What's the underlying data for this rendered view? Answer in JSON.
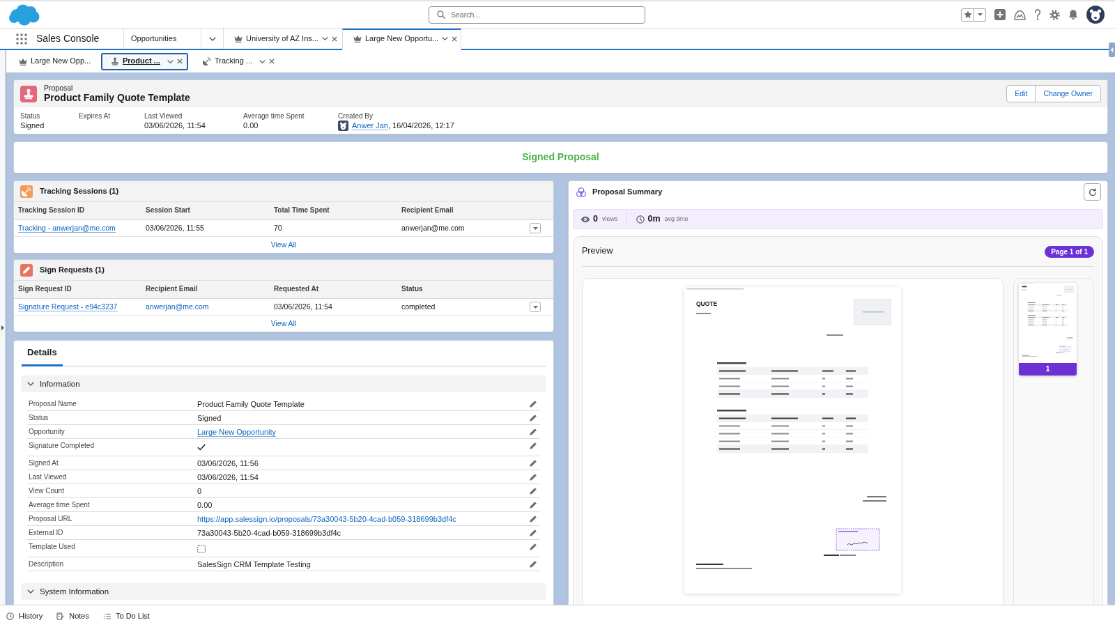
{
  "global_header": {
    "search": {
      "placeholder": "Search..."
    }
  },
  "app": {
    "name": "Sales Console"
  },
  "nav": {
    "object_tab": {
      "label": "Opportunities"
    },
    "tabs": [
      {
        "label": "University of AZ Ins...",
        "kind": "opportunity",
        "selected": false
      },
      {
        "label": "Large New Opportu...",
        "kind": "opportunity",
        "selected": true
      }
    ]
  },
  "subtabs": [
    {
      "label": "Large New Opp...",
      "kind": "opportunity",
      "selected": false,
      "closable": false
    },
    {
      "label": "Product ...",
      "kind": "proposal",
      "selected": true,
      "closable": true
    },
    {
      "label": "Tracking ...",
      "kind": "tracking",
      "selected": false,
      "closable": true
    }
  ],
  "record": {
    "object_label": "Proposal",
    "title": "Product Family Quote Template",
    "actions": [
      "Edit",
      "Change Owner"
    ],
    "highlights": [
      {
        "label": "Status",
        "kind": "text",
        "value": "Signed"
      },
      {
        "label": "Expires At",
        "kind": "text"
      },
      {
        "label": "Last Viewed",
        "kind": "text",
        "value": "03/06/2026, 11:54"
      },
      {
        "label": "Average time Spent",
        "kind": "text",
        "value": "0.00"
      },
      {
        "label": "Created By",
        "kind": "user",
        "value": "Anwer Jan",
        "suffix": ", 16/04/2026, 12:17"
      }
    ]
  },
  "status_banner": {
    "text": "Signed Proposal"
  },
  "related_lists": [
    {
      "kind": "tracking",
      "title": "Tracking Sessions (1)",
      "columns": [
        "Tracking Session ID",
        "Session Start",
        "Total Time Spent",
        "Recipient Email"
      ],
      "rows": [
        {
          "cells": [
            {
              "kind": "record_link",
              "text": "Tracking - anwerjan@me.com"
            },
            {
              "kind": "datetime",
              "text": "03/06/2026, 11:55"
            },
            {
              "kind": "number",
              "text": "70"
            },
            {
              "kind": "email",
              "text": "anwerjan@me.com"
            }
          ]
        }
      ],
      "view_all": "View All"
    },
    {
      "kind": "sign",
      "title": "Sign Requests (1)",
      "columns": [
        "Sign Request ID",
        "Recipient Email",
        "Requested At",
        "Status"
      ],
      "rows": [
        {
          "cells": [
            {
              "kind": "record_link",
              "text": "Signature Request - e94c3237"
            },
            {
              "kind": "email_link",
              "text": "anwerjan@me.com"
            },
            {
              "kind": "datetime",
              "text": "03/06/2026, 11:54"
            },
            {
              "kind": "status",
              "text": "completed"
            }
          ]
        }
      ],
      "view_all": "View All"
    }
  ],
  "details": {
    "tabs": [
      {
        "label": "Details",
        "selected": true
      }
    ],
    "sections": [
      {
        "title": "Information",
        "expanded": true,
        "fields": [
          {
            "label": "Proposal Name",
            "kind": "text",
            "value": "Product Family Quote Template"
          },
          {
            "label": "Status",
            "kind": "text",
            "value": "Signed"
          },
          {
            "label": "Opportunity",
            "kind": "record_link",
            "value": "Large New Opportunity"
          },
          {
            "label": "Signature Completed",
            "kind": "checkbox",
            "checked": true
          },
          {
            "label": "Signed At",
            "kind": "text",
            "value": "03/06/2026, 11:56"
          },
          {
            "label": "Last Viewed",
            "kind": "text",
            "value": "03/06/2026, 11:54"
          },
          {
            "label": "View Count",
            "kind": "text",
            "value": "0"
          },
          {
            "label": "Average time Spent",
            "kind": "text",
            "value": "0.00"
          },
          {
            "label": "Proposal URL",
            "kind": "url",
            "value": "https://app.salessign.io/proposals/73a30043-5b20-4cad-b059-318699b3df4c"
          },
          {
            "label": "External ID",
            "kind": "text",
            "value": "73a30043-5b20-4cad-b059-318699b3df4c"
          },
          {
            "label": "Template Used",
            "kind": "checkbox",
            "checked": false
          },
          {
            "label": "Description",
            "kind": "text",
            "value": "SalesSign CRM Template Testing"
          }
        ]
      },
      {
        "title": "System Information",
        "expanded": true
      }
    ]
  },
  "summary": {
    "title": "Proposal Summary",
    "stats": [
      {
        "kind": "views",
        "value": "0",
        "unit": "views"
      },
      {
        "kind": "time",
        "value": "0m",
        "unit": "avg time"
      }
    ],
    "preview": {
      "title": "Preview",
      "page_badge": "Page 1 of 1",
      "document": {
        "heading": "QUOTE"
      },
      "thumbnails": [
        {
          "label": "1",
          "selected": true
        }
      ]
    }
  },
  "utility_bar": [
    {
      "kind": "history",
      "label": "History"
    },
    {
      "kind": "notes",
      "label": "Notes"
    },
    {
      "kind": "todo",
      "label": "To Do List"
    }
  ]
}
